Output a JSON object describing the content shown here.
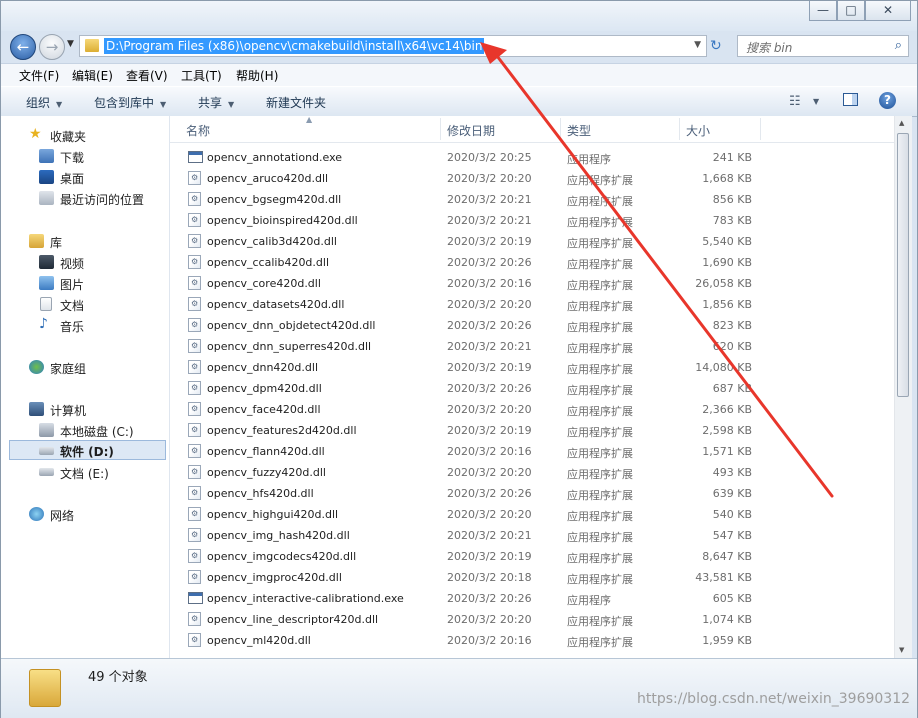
{
  "window": {
    "controls": {
      "minimize": "—",
      "maximize": "□",
      "close": "✕"
    }
  },
  "nav": {
    "back_icon": "←",
    "forward_icon": "→",
    "address": "D:\\Program Files (x86)\\opencv\\cmakebuild\\install\\x64\\vc14\\bin",
    "search_placeholder": "搜索 bin",
    "refresh_icon": "↻",
    "search_icon": "⌕"
  },
  "menu": [
    "文件(F)",
    "编辑(E)",
    "查看(V)",
    "工具(T)",
    "帮助(H)"
  ],
  "toolbar": {
    "organize": "组织",
    "include_in_library": "包含到库中",
    "share": "共享",
    "new_folder": "新建文件夹",
    "help": "?"
  },
  "sidebar": {
    "favorites": "收藏夹",
    "downloads": "下载",
    "desktop": "桌面",
    "recent": "最近访问的位置",
    "libraries": "库",
    "videos": "视频",
    "pictures": "图片",
    "documents": "文档",
    "music": "音乐",
    "homegroup": "家庭组",
    "computer": "计算机",
    "local_disk_c": "本地磁盘 (C:)",
    "software_d": "软件 (D:)",
    "docs_e": "文档 (E:)",
    "network": "网络"
  },
  "columns": {
    "name": "名称",
    "date": "修改日期",
    "type": "类型",
    "size": "大小"
  },
  "files": [
    {
      "name": "opencv_annotationd.exe",
      "date": "2020/3/2 20:25",
      "type": "应用程序",
      "size": "241 KB",
      "kind": "exe"
    },
    {
      "name": "opencv_aruco420d.dll",
      "date": "2020/3/2 20:20",
      "type": "应用程序扩展",
      "size": "1,668 KB",
      "kind": "dll"
    },
    {
      "name": "opencv_bgsegm420d.dll",
      "date": "2020/3/2 20:21",
      "type": "应用程序扩展",
      "size": "856 KB",
      "kind": "dll"
    },
    {
      "name": "opencv_bioinspired420d.dll",
      "date": "2020/3/2 20:21",
      "type": "应用程序扩展",
      "size": "783 KB",
      "kind": "dll"
    },
    {
      "name": "opencv_calib3d420d.dll",
      "date": "2020/3/2 20:19",
      "type": "应用程序扩展",
      "size": "5,540 KB",
      "kind": "dll"
    },
    {
      "name": "opencv_ccalib420d.dll",
      "date": "2020/3/2 20:26",
      "type": "应用程序扩展",
      "size": "1,690 KB",
      "kind": "dll"
    },
    {
      "name": "opencv_core420d.dll",
      "date": "2020/3/2 20:16",
      "type": "应用程序扩展",
      "size": "26,058 KB",
      "kind": "dll"
    },
    {
      "name": "opencv_datasets420d.dll",
      "date": "2020/3/2 20:20",
      "type": "应用程序扩展",
      "size": "1,856 KB",
      "kind": "dll"
    },
    {
      "name": "opencv_dnn_objdetect420d.dll",
      "date": "2020/3/2 20:26",
      "type": "应用程序扩展",
      "size": "823 KB",
      "kind": "dll"
    },
    {
      "name": "opencv_dnn_superres420d.dll",
      "date": "2020/3/2 20:21",
      "type": "应用程序扩展",
      "size": "620 KB",
      "kind": "dll"
    },
    {
      "name": "opencv_dnn420d.dll",
      "date": "2020/3/2 20:19",
      "type": "应用程序扩展",
      "size": "14,080 KB",
      "kind": "dll"
    },
    {
      "name": "opencv_dpm420d.dll",
      "date": "2020/3/2 20:26",
      "type": "应用程序扩展",
      "size": "687 KB",
      "kind": "dll"
    },
    {
      "name": "opencv_face420d.dll",
      "date": "2020/3/2 20:20",
      "type": "应用程序扩展",
      "size": "2,366 KB",
      "kind": "dll"
    },
    {
      "name": "opencv_features2d420d.dll",
      "date": "2020/3/2 20:19",
      "type": "应用程序扩展",
      "size": "2,598 KB",
      "kind": "dll"
    },
    {
      "name": "opencv_flann420d.dll",
      "date": "2020/3/2 20:16",
      "type": "应用程序扩展",
      "size": "1,571 KB",
      "kind": "dll"
    },
    {
      "name": "opencv_fuzzy420d.dll",
      "date": "2020/3/2 20:20",
      "type": "应用程序扩展",
      "size": "493 KB",
      "kind": "dll"
    },
    {
      "name": "opencv_hfs420d.dll",
      "date": "2020/3/2 20:26",
      "type": "应用程序扩展",
      "size": "639 KB",
      "kind": "dll"
    },
    {
      "name": "opencv_highgui420d.dll",
      "date": "2020/3/2 20:20",
      "type": "应用程序扩展",
      "size": "540 KB",
      "kind": "dll"
    },
    {
      "name": "opencv_img_hash420d.dll",
      "date": "2020/3/2 20:21",
      "type": "应用程序扩展",
      "size": "547 KB",
      "kind": "dll"
    },
    {
      "name": "opencv_imgcodecs420d.dll",
      "date": "2020/3/2 20:19",
      "type": "应用程序扩展",
      "size": "8,647 KB",
      "kind": "dll"
    },
    {
      "name": "opencv_imgproc420d.dll",
      "date": "2020/3/2 20:18",
      "type": "应用程序扩展",
      "size": "43,581 KB",
      "kind": "dll"
    },
    {
      "name": "opencv_interactive-calibrationd.exe",
      "date": "2020/3/2 20:26",
      "type": "应用程序",
      "size": "605 KB",
      "kind": "exe"
    },
    {
      "name": "opencv_line_descriptor420d.dll",
      "date": "2020/3/2 20:20",
      "type": "应用程序扩展",
      "size": "1,074 KB",
      "kind": "dll"
    },
    {
      "name": "opencv_ml420d.dll",
      "date": "2020/3/2 20:16",
      "type": "应用程序扩展",
      "size": "1,959 KB",
      "kind": "dll"
    }
  ],
  "status": {
    "count_text": "49 个对象"
  },
  "watermark": "https://blog.csdn.net/weixin_39690312",
  "colors": {
    "annotation_arrow": "#e8362b",
    "selection": "#3399ff"
  }
}
